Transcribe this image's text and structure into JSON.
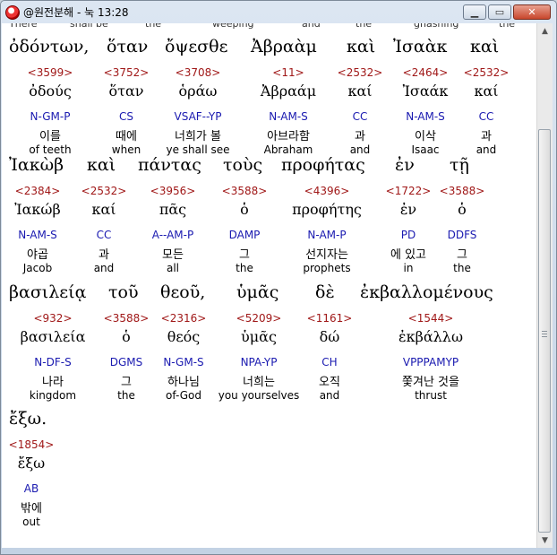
{
  "window": {
    "title": "@원전분해 - 눅 13:28"
  },
  "top_partial": [
    "There",
    "shall be",
    "the",
    "weeping",
    "and",
    "the",
    "gnashing",
    "the"
  ],
  "rows": [
    {
      "greek": [
        "ὀδόντων,",
        "ὅταν",
        "ὄψεσθε",
        "Ἀβραὰμ",
        "καὶ",
        "Ἰσαὰκ",
        "καὶ"
      ],
      "words": [
        {
          "strong": "<3599>",
          "lemma": "ὀδούς",
          "morph": "N-GM-P",
          "kor": "이를",
          "eng": "of teeth"
        },
        {
          "strong": "<3752>",
          "lemma": "ὅταν",
          "morph": "CS",
          "kor": "때에",
          "eng": "when"
        },
        {
          "strong": "<3708>",
          "lemma": "ὁράω",
          "morph": "VSAF--YP",
          "kor": "너희가 볼",
          "eng": "ye shall see"
        },
        {
          "strong": "<11>",
          "lemma": "Ἀβραάμ",
          "morph": "N-AM-S",
          "kor": "아브라함",
          "eng": "Abraham"
        },
        {
          "strong": "<2532>",
          "lemma": "καί",
          "morph": "CC",
          "kor": "과",
          "eng": "and"
        },
        {
          "strong": "<2464>",
          "lemma": "Ἰσαάκ",
          "morph": "N-AM-S",
          "kor": "이삭",
          "eng": "Isaac"
        },
        {
          "strong": "<2532>",
          "lemma": "καί",
          "morph": "CC",
          "kor": "과",
          "eng": "and"
        }
      ]
    },
    {
      "greek": [
        "Ἰακὼβ",
        "καὶ",
        "πάντας",
        "τοὺς",
        "προφήτας",
        "ἐν",
        "τῇ"
      ],
      "words": [
        {
          "strong": "<2384>",
          "lemma": "Ἰακώβ",
          "morph": "N-AM-S",
          "kor": "야곱",
          "eng": "Jacob"
        },
        {
          "strong": "<2532>",
          "lemma": "καί",
          "morph": "CC",
          "kor": "과",
          "eng": "and"
        },
        {
          "strong": "<3956>",
          "lemma": "πᾶς",
          "morph": "A--AM-P",
          "kor": "모든",
          "eng": "all"
        },
        {
          "strong": "<3588>",
          "lemma": "ὁ",
          "morph": "DAMP",
          "kor": "그",
          "eng": "the"
        },
        {
          "strong": "<4396>",
          "lemma": "προφήτης",
          "morph": "N-AM-P",
          "kor": "선지자는",
          "eng": "prophets"
        },
        {
          "strong": "<1722>",
          "lemma": "ἐν",
          "morph": "PD",
          "kor": "에 있고",
          "eng": "in"
        },
        {
          "strong": "<3588>",
          "lemma": "ὁ",
          "morph": "DDFS",
          "kor": "그",
          "eng": "the"
        }
      ]
    },
    {
      "greek": [
        "βασιλείᾳ",
        "τοῦ",
        "θεοῦ,",
        "ὑμᾶς",
        "δὲ",
        "ἐκβαλλομένους"
      ],
      "words": [
        {
          "strong": "<932>",
          "lemma": "βασιλεία",
          "morph": "N-DF-S",
          "kor": "나라",
          "eng": "kingdom"
        },
        {
          "strong": "<3588>",
          "lemma": "ὁ",
          "morph": "DGMS",
          "kor": "그",
          "eng": "the"
        },
        {
          "strong": "<2316>",
          "lemma": "θεός",
          "morph": "N-GM-S",
          "kor": "하나님",
          "eng": "of-God"
        },
        {
          "strong": "<5209>",
          "lemma": "ὑμᾶς",
          "morph": "NPA-YP",
          "kor": "너희는",
          "eng": "you yourselves"
        },
        {
          "strong": "<1161>",
          "lemma": "δώ",
          "morph": "CH",
          "kor": "오직",
          "eng": "and"
        },
        {
          "strong": "<1544>",
          "lemma": "ἐκβάλλω",
          "morph": "VPPPAMYP",
          "kor": "쫓겨난 것을",
          "eng": "thrust"
        }
      ]
    },
    {
      "greek": [
        "ἔξω."
      ],
      "words": [
        {
          "strong": "<1854>",
          "lemma": "ἔξω",
          "morph": "AB",
          "kor": "밖에",
          "eng": "out"
        }
      ]
    }
  ]
}
